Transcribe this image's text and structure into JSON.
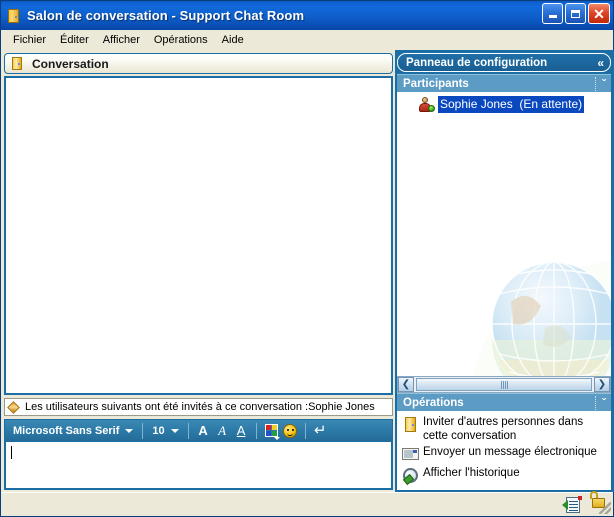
{
  "window": {
    "title": "Salon de conversation - Support Chat Room",
    "icon": "door-icon",
    "controls": {
      "minimize": "_",
      "maximize": "□",
      "close": "✕"
    }
  },
  "menubar": {
    "items": [
      {
        "label": "Fichier"
      },
      {
        "label": "Éditer"
      },
      {
        "label": "Afficher"
      },
      {
        "label": "Opérations"
      },
      {
        "label": "Aide"
      }
    ]
  },
  "conversation": {
    "header_title": "Conversation",
    "header_icon": "door-icon",
    "log_text": "",
    "status_message": "Les utilisateurs suivants ont été invités à ce conversation :Sophie Jones",
    "status_icon": "diamond-icon"
  },
  "format_toolbar": {
    "font_family": "Microsoft Sans Serif",
    "font_size": "10",
    "bold_label": "A",
    "italic_label": "A",
    "underline_label": "A",
    "color_icon": "color-palette-icon",
    "emoticon_icon": "smiley-icon",
    "send_label": "↵"
  },
  "message_input": {
    "value": "",
    "placeholder": ""
  },
  "config_panel": {
    "title": "Panneau de configuration",
    "collapse_label": "«",
    "sections": [
      {
        "title": "Participants",
        "chevron": "ˇ",
        "participants": [
          {
            "name": "Sophie Jones",
            "status": "(En attente)",
            "icon": "person-online-icon"
          }
        ]
      },
      {
        "title": "Opérations",
        "chevron": "ˇ",
        "actions": [
          {
            "label": "Inviter d'autres personnes dans cette conversation",
            "icon": "door-icon"
          },
          {
            "label": "Envoyer un message électronique",
            "icon": "envelope-icon"
          },
          {
            "label": "Afficher l'historique",
            "icon": "history-magnifier-icon"
          }
        ]
      }
    ],
    "scrollbar": {
      "left_arrow": "❮",
      "right_arrow": "❯"
    }
  },
  "statusbar": {
    "icons": [
      {
        "name": "log-document-icon"
      },
      {
        "name": "lock-icon"
      }
    ]
  },
  "colors": {
    "titlebar_blue": "#0f63d4",
    "panel_blue": "#1b6ea5",
    "section_blue": "#5b9bc4",
    "selection_blue": "#0a48c0",
    "toolbar_blue": "#2c7aa8",
    "chrome_beige": "#ece9d8",
    "close_red": "#e0472a"
  }
}
